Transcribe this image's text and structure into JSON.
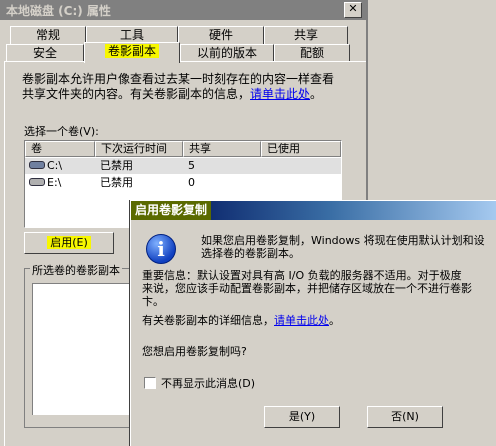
{
  "window": {
    "title": "本地磁盘 (C:) 属性",
    "close_glyph": "✕"
  },
  "tabs": {
    "row1": [
      "常规",
      "工具",
      "硬件",
      "共享"
    ],
    "row2": [
      "安全",
      "卷影副本",
      "以前的版本",
      "配额"
    ],
    "active": "卷影副本"
  },
  "main": {
    "description_line1": "卷影副本允许用户像查看过去某一时刻存在的内容一样查看",
    "description_line2_prefix": "共享文件夹的内容。有关卷影副本的信息，",
    "description_link": "请单击此处",
    "description_suffix": "。",
    "select_volume_label": "选择一个卷(V):",
    "columns": [
      "卷",
      "下次运行时间",
      "共享",
      "已使用"
    ],
    "volumes": [
      {
        "volume": "C:\\",
        "next_run": "已禁用",
        "shares": "5",
        "used": "",
        "icon": "drive-icon"
      },
      {
        "volume": "E:\\",
        "next_run": "已禁用",
        "shares": "0",
        "used": "",
        "icon": "drive-icon"
      }
    ],
    "enable_button": "启用(E)",
    "snapshots_group_label": "所选卷的卷影副本"
  },
  "dialog": {
    "title": "启用卷影复制",
    "icon": "info-icon",
    "line1": "如果您启用卷影复制，Windows 将现在使用默认计划和设",
    "line2": "选择卷的卷影副本。",
    "line3": "重要信息：默认设置对具有高 I/O 负载的服务器不适用。对于极度",
    "line4": "来说，您应该手动配置卷影副本，并把储存区域放在一个不进行卷影",
    "line5": "卞。",
    "more_info_prefix": "有关卷影副本的详细信息，",
    "more_info_link": "请单击此处",
    "more_info_suffix": "。",
    "question": "您想启用卷影复制吗?",
    "dont_show_label": "不再显示此消息(D)",
    "yes_button": "是(Y)",
    "no_button": "否(N)"
  }
}
